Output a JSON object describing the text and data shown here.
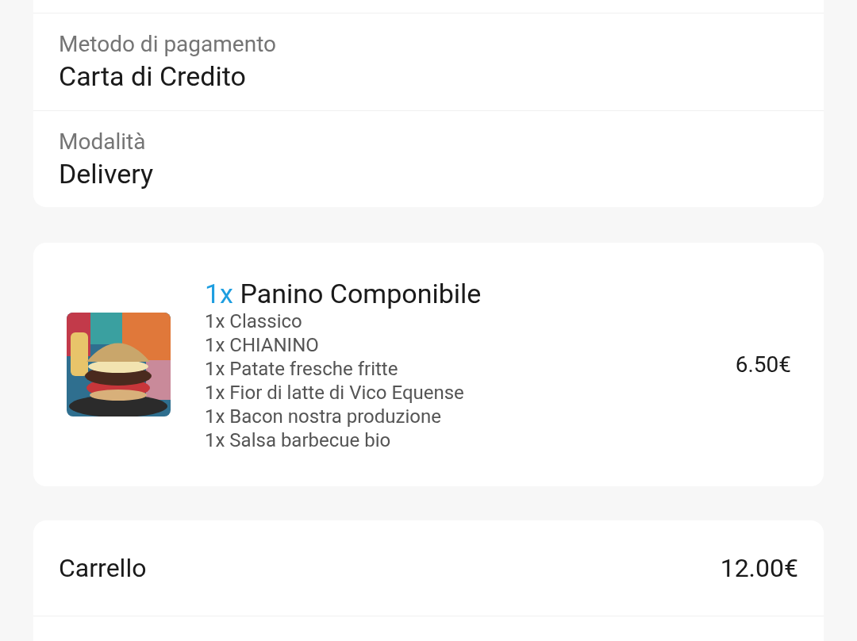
{
  "payment": {
    "label": "Metodo di pagamento",
    "value": "Carta di Credito"
  },
  "mode": {
    "label": "Modalità",
    "value": "Delivery"
  },
  "items": [
    {
      "quantity": "1x",
      "name": "Panino Componibile",
      "options": [
        "1x Classico",
        "1x CHIANINO",
        "1x Patate fresche fritte",
        "1x Fior di latte di Vico Equense",
        "1x Bacon nostra produzione",
        "1x Salsa barbecue bio"
      ],
      "price": "6.50€"
    }
  ],
  "summary": [
    {
      "label": "Carrello",
      "value": "12.00€"
    }
  ]
}
